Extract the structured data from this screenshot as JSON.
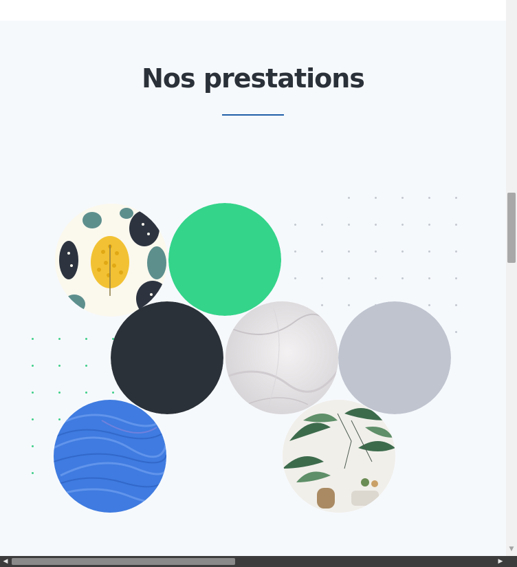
{
  "section": {
    "title": "Nos prestations",
    "background": "#f6f9fc",
    "underline_color": "#1f5fa8"
  },
  "colors": {
    "green_circle": "#34d48a",
    "dark_circle": "#2b3138",
    "grey_circle": "#bfc4cf",
    "blue_circle": "#3f7be0",
    "grey_dots": "#c3c9d0",
    "green_dots": "#3fcf8a"
  },
  "prestations": [
    {
      "name": "leaf-pattern-wallpaper-circle",
      "kind": "image"
    },
    {
      "name": "green-color-circle",
      "kind": "color"
    },
    {
      "name": "dark-color-circle",
      "kind": "color"
    },
    {
      "name": "marble-texture-circle",
      "kind": "image"
    },
    {
      "name": "grey-color-circle",
      "kind": "color"
    },
    {
      "name": "blue-paint-texture-circle",
      "kind": "image"
    },
    {
      "name": "tropical-wallpaper-circle",
      "kind": "image"
    }
  ],
  "icons": {
    "scroll_up": "chevron-up-icon",
    "scroll_down": "chevron-down-icon",
    "scroll_left": "chevron-left-icon",
    "scroll_right": "chevron-right-icon"
  },
  "scrollbars": {
    "vertical_arrow": "▼",
    "left_arrow": "◀",
    "right_arrow": "▶"
  }
}
